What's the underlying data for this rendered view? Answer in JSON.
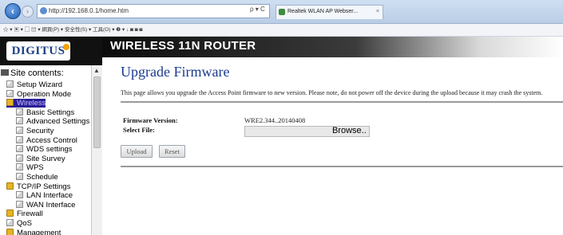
{
  "browser": {
    "url": "http://192.168.0.1/home.htm",
    "url_tools": "ρ ▾ C",
    "tab_title": "Realtek WLAN AP Webser...",
    "tab_close": "×",
    "command_bar": "☆ ▾  ▣ ▾  ▢  ▤ ▾  網頁(P) ▾  安全性(S) ▾  工具(O) ▾  ❷ ▾  ↓  ◙  ◙  ◙"
  },
  "sidebar": {
    "logo": "DIGITUS",
    "title": "Site contents:",
    "items": [
      {
        "label": "Setup Wizard",
        "icon": "page-icon"
      },
      {
        "label": "Operation Mode",
        "icon": "page-icon"
      },
      {
        "label": "Wireless",
        "icon": "folder-icon",
        "active": true
      },
      {
        "label": "Basic Settings",
        "icon": "page-icon"
      },
      {
        "label": "Advanced Settings",
        "icon": "page-icon"
      },
      {
        "label": "Security",
        "icon": "page-icon"
      },
      {
        "label": "Access Control",
        "icon": "page-icon"
      },
      {
        "label": "WDS settings",
        "icon": "page-icon"
      },
      {
        "label": "Site Survey",
        "icon": "page-icon"
      },
      {
        "label": "WPS",
        "icon": "page-icon"
      },
      {
        "label": "Schedule",
        "icon": "page-icon"
      },
      {
        "label": "TCP/IP Settings",
        "icon": "folder-icon"
      },
      {
        "label": "LAN Interface",
        "icon": "page-icon"
      },
      {
        "label": "WAN Interface",
        "icon": "page-icon"
      },
      {
        "label": "Firewall",
        "icon": "folder-icon"
      },
      {
        "label": "QoS",
        "icon": "page-icon"
      },
      {
        "label": "Management",
        "icon": "folder-icon"
      }
    ]
  },
  "banner": {
    "title": "WIRELESS 11N ROUTER"
  },
  "main": {
    "title": "Upgrade Firmware",
    "description": "This page allows you upgrade the Access Point firmware to new version. Please note, do not power off the device during the upload because it may crash the system.",
    "firmware_label": "Firmware Version:",
    "firmware_value": "WRE2.344..20140408",
    "file_label": "Select File:",
    "browse_label": "Browse..",
    "upload_label": "Upload",
    "reset_label": "Reset"
  },
  "colors": {
    "title_blue": "#1b3a8f",
    "active_nav_bg": "#2a1e96",
    "sidebar_bg": "#111111"
  }
}
